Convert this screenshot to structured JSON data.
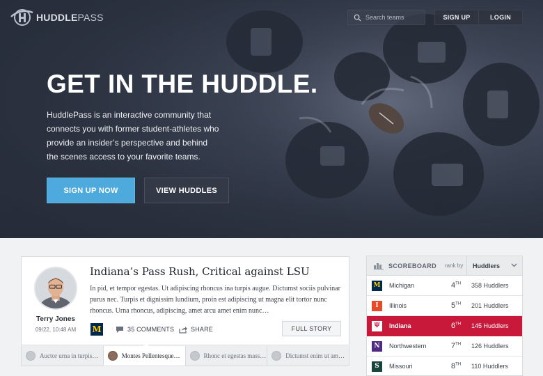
{
  "brand": {
    "name_bold": "HUDDLE",
    "name_light": "PASS"
  },
  "header": {
    "search_placeholder": "Search teams",
    "signup_label": "SIGN UP",
    "login_label": "LOGIN"
  },
  "hero": {
    "title": "GET IN THE HUDDLE.",
    "text": "HuddlePass is an interactive community that connects you with former student-athletes who provide an insider’s perspective and behind the scenes access to your favorite teams.",
    "primary_cta": "SIGN UP NOW",
    "secondary_cta": "VIEW HUDDLES"
  },
  "story": {
    "author": "Terry Jones",
    "date": "09/22, 10:48 AM",
    "title": "Indiana’s Pass Rush, Critical against LSU",
    "excerpt": "In pid, et tempor egestas. Ut adipiscing rhoncus ina turpis augue. Dictumst sociis pulvinar purus nec. Turpis et dignissim lundium, proin est adipiscing ut magna elit tortor nunc rhoncus. Urna rhoncus, adipiscing, amet arcu amet enim nunc…",
    "team_logo_letter": "M",
    "comments_label": "35 COMMENTS",
    "share_label": "SHARE",
    "full_story_label": "FULL STORY"
  },
  "story_tabs": [
    {
      "label": "Auctor urna in turpis…",
      "active": false
    },
    {
      "label": "Montes Pellentesque…",
      "active": true
    },
    {
      "label": "Rhonc et egestas mass…",
      "active": false
    },
    {
      "label": "Dictumst enim ut am…",
      "active": false
    }
  ],
  "scoreboard": {
    "title": "SCOREBOARD",
    "rank_by_label": "rank by",
    "rank_by_value": "Huddlers",
    "rows": [
      {
        "team": "Michigan",
        "rank": "4",
        "suffix": "TH",
        "count": "358 Huddlers",
        "logo_letter": "M",
        "logo_bg": "#00274c",
        "logo_fg": "#ffcb05",
        "highlight": false
      },
      {
        "team": "Illinois",
        "rank": "5",
        "suffix": "TH",
        "count": "201 Huddlers",
        "logo_letter": "I",
        "logo_bg": "#e84a27",
        "logo_fg": "#ffffff",
        "highlight": false
      },
      {
        "team": "Indiana",
        "rank": "6",
        "suffix": "TH",
        "count": "145 Huddlers",
        "logo_letter": "Ψ",
        "logo_bg": "#c8193b",
        "logo_fg": "#ffffff",
        "highlight": true
      },
      {
        "team": "Northwestern",
        "rank": "7",
        "suffix": "TH",
        "count": "126 Huddlers",
        "logo_letter": "N",
        "logo_bg": "#4e2a84",
        "logo_fg": "#ffffff",
        "highlight": false
      },
      {
        "team": "Missouri",
        "rank": "8",
        "suffix": "TH",
        "count": "110 Huddlers",
        "logo_letter": "S",
        "logo_bg": "#18453b",
        "logo_fg": "#ffffff",
        "highlight": false
      }
    ]
  },
  "colors": {
    "accent_blue": "#4ea9dc",
    "highlight_red": "#c8193b"
  },
  "icons": [
    "logo-mark-icon",
    "search-icon",
    "comment-icon",
    "share-icon",
    "bar-chart-icon",
    "chevron-down-icon"
  ]
}
